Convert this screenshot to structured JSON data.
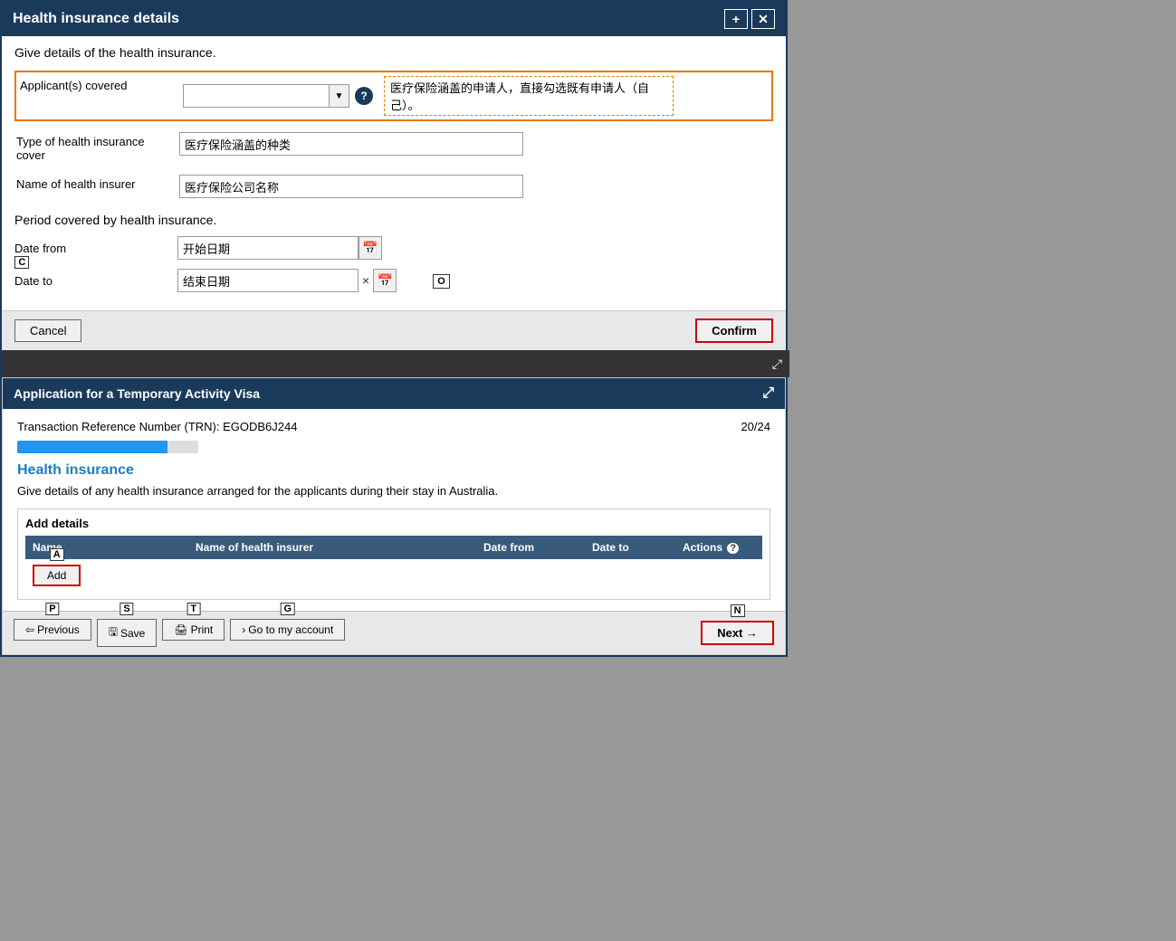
{
  "modal": {
    "title": "Health insurance details",
    "add_btn": "+",
    "close_btn": "✕",
    "description": "Give details of the health insurance.",
    "fields": {
      "applicants_label": "Applicant(s) covered",
      "applicants_placeholder": "",
      "applicants_annotation": "医疗保险涵盖的申请人，直接勾选既有申请人（自己）。",
      "type_label": "Type of health insurance cover",
      "type_value": "医疗保险涵盖的种类",
      "insurer_label": "Name of health insurer",
      "insurer_value": "医疗保险公司名称"
    },
    "period_title": "Period covered by health insurance.",
    "date_from_label": "Date from",
    "date_from_value": "开始日期",
    "date_to_label": "Date to",
    "date_to_value": "结束日期",
    "cancel_label": "Cancel",
    "confirm_label": "Confirm",
    "kb_cancel": "C",
    "kb_confirm": "O"
  },
  "dark_bar": {
    "expand_icon": "⤢"
  },
  "main_page": {
    "header": "Application for a Temporary Activity Visa",
    "trn_label": "Transaction Reference Number (TRN): EGODB6J244",
    "progress_label": "20/24",
    "progress_pct": 83,
    "section_title": "Health insurance",
    "section_desc": "Give details of any health insurance arranged for the applicants during their stay in Australia.",
    "add_details_title": "Add details",
    "table_headers": {
      "name": "Name",
      "insurer": "Name of health insurer",
      "date_from": "Date from",
      "date_to": "Date to",
      "actions": "Actions"
    },
    "add_label": "Add",
    "kb_add": "A",
    "nav": {
      "previous_label": "Previous",
      "save_label": "Save",
      "print_label": "Print",
      "goto_label": "Go to my account",
      "next_label": "Next →",
      "kb_prev": "P",
      "kb_save": "S",
      "kb_print": "T",
      "kb_goto": "G",
      "kb_next": "N"
    }
  }
}
